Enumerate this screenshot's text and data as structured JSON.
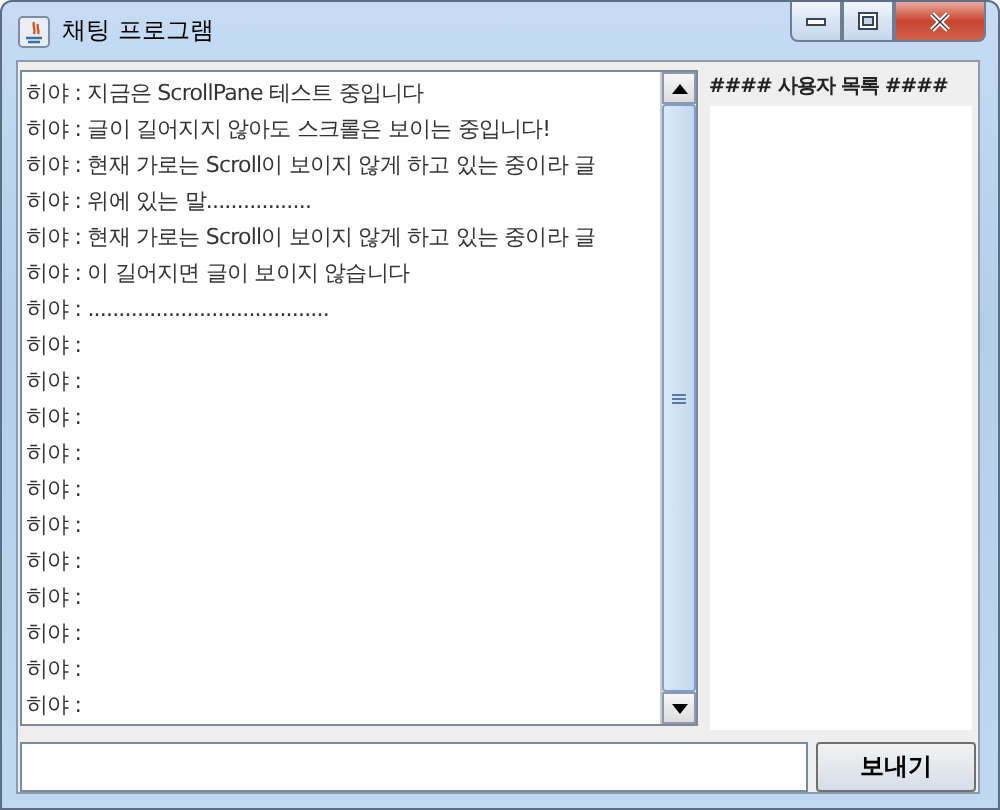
{
  "window": {
    "title": "채팅 프로그램"
  },
  "chat_log": {
    "lines": [
      "히야 : 지금은 ScrollPane 테스트 중입니다",
      "히야 : 글이 길어지지 않아도 스크롤은 보이는 중입니다!",
      "히야 : 현재 가로는 Scroll이 보이지 않게 하고 있는 중이라 글",
      "히야 : 위에 있는 말.................",
      "히야 : 현재 가로는 Scroll이 보이지 않게 하고 있는 중이라 글",
      "히야 : 이 길어지면 글이 보이지 않습니다",
      "히야 : .......................................",
      "히야 :",
      "히야 :",
      "히야 :",
      "히야 :",
      "히야 :",
      "히야 :",
      "히야 :",
      "히야 :",
      "히야 :",
      "히야 :",
      "히야 :"
    ]
  },
  "user_list": {
    "header": "#### 사용자 목록 ####"
  },
  "send_button": {
    "label": "보내기"
  }
}
